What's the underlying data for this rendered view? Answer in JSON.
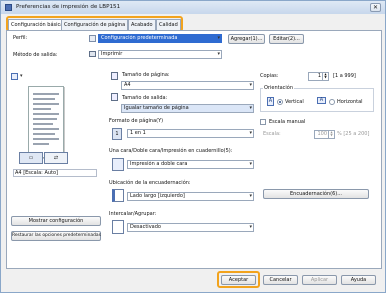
{
  "window": {
    "title": "Preferencias de impresión de LBP151",
    "close": "✕"
  },
  "tabs": [
    "Configuración básica",
    "Configuración de página",
    "Acabado",
    "Calidad"
  ],
  "profile": {
    "label": "Perfil:",
    "value": "Configuración predeterminada",
    "add": "Agregar(1)...",
    "edit": "Editar(2)..."
  },
  "output": {
    "label": "Método de salida:",
    "value": "Imprimir"
  },
  "preview": {
    "caption": "A4 [Escala: Auto]"
  },
  "page_size": {
    "label": "Tamaño de página:",
    "value": "A4"
  },
  "output_size": {
    "label": "Tamaño de salida:",
    "value": "Igualar tamaño de página"
  },
  "copies": {
    "label": "Copias:",
    "value": "1",
    "range": "[1 a 999]"
  },
  "orientation": {
    "label": "Orientación",
    "vertical": "Vertical",
    "horizontal": "Horizontal"
  },
  "layout": {
    "label": "Formato de página(Y)",
    "value": "1 en 1"
  },
  "scale": {
    "label": "Escala manual",
    "sublabel": "Escala:",
    "value": "100",
    "range": "% [25 a 200]"
  },
  "duplex": {
    "label": "Una cara/Doble cara/Impresión en cuadernillo(5):",
    "value": "Impresión a doble cara"
  },
  "binding": {
    "label": "Ubicación de la encuadernación:",
    "value": "Lado largo [izquierdo]",
    "button": "Encuadernación(6)..."
  },
  "collate": {
    "label": "Intercalar/Agrupar:",
    "value": "Desactivado"
  },
  "left_buttons": {
    "show_settings": "Mostrar configuración",
    "restore_defaults": "Restaurar las opciones predeterminadas"
  },
  "footer": {
    "ok": "Aceptar",
    "cancel": "Cancelar",
    "apply": "Aplicar",
    "help": "Ayuda"
  },
  "colors": {
    "highlight": "#f2a31d",
    "selection": "#2f6bd1"
  }
}
